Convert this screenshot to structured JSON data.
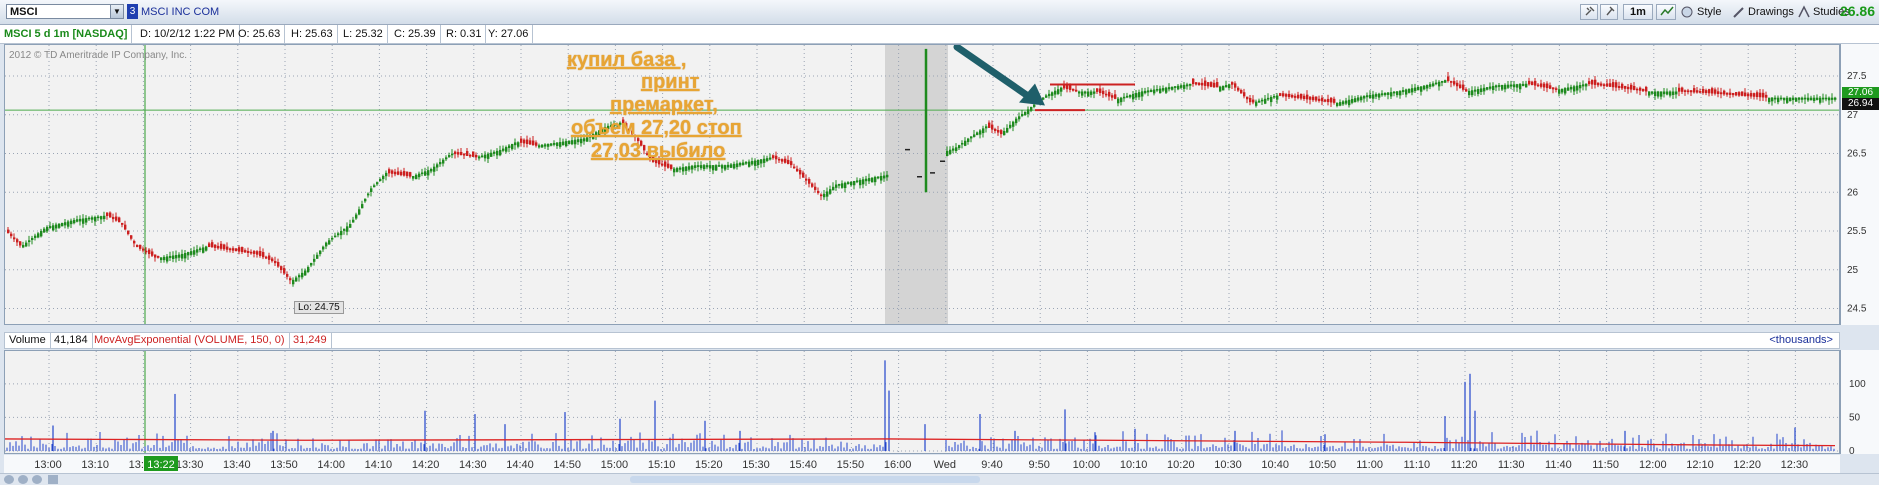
{
  "toolbar": {
    "symbol": "MSCI",
    "link_badge": "3",
    "company": "MSCI INC COM",
    "aggregation": "1m",
    "style_label": "Style",
    "drawings_label": "Drawings",
    "studies_label": "Studies",
    "last_price": "26.86"
  },
  "infobar": {
    "title": "MSCI 5 d 1m [NASDAQ]",
    "date": "D: 10/2/12 1:22 PM",
    "open": "O: 25.63",
    "high": "H: 25.63",
    "low": "L: 25.32",
    "close": "C: 25.39",
    "range": "R: 0.31",
    "y": "Y: 27.06"
  },
  "copyright": "2012 © TD Ameritrade IP Company, Inc.",
  "low_label": "Lo: 24.75",
  "price_tags": {
    "current": "27.06",
    "last": "26.94"
  },
  "annotation": {
    "lines": [
      "купил база ,",
      "принт",
      "премаркет,",
      "объем 27,20 стоп",
      "27,03 выбило"
    ]
  },
  "volume_header": {
    "label": "Volume",
    "value": "41,184",
    "study": "MovAvgExponential (VOLUME, 150, 0)",
    "study_value": "31,249",
    "units": "<thousands>"
  },
  "colors": {
    "up": "#1e8a1e",
    "down": "#cc1f1f",
    "volume": "#2244cc",
    "ema": "#dd2222",
    "annotation": "#e8a534",
    "arrow": "#1f5f6a"
  },
  "chart_data": {
    "type": "candlestick",
    "y_ticks": [
      24.5,
      25,
      25.5,
      26,
      26.5,
      27,
      27.5
    ],
    "ylim": [
      24.3,
      27.9
    ],
    "volume_ticks": [
      0,
      50,
      100
    ],
    "volume_ylim": [
      0,
      140
    ],
    "time_labels": [
      "13:00",
      "13:10",
      "13:20",
      "13:30",
      "13:40",
      "13:50",
      "14:00",
      "14:10",
      "14:20",
      "14:30",
      "14:40",
      "14:50",
      "15:00",
      "15:10",
      "15:20",
      "15:30",
      "15:40",
      "15:50",
      "16:00",
      "Wed",
      "9:40",
      "9:50",
      "10:00",
      "10:10",
      "10:20",
      "10:30",
      "10:40",
      "10:50",
      "11:00",
      "11:10",
      "11:20",
      "11:30",
      "11:40",
      "11:50",
      "12:00",
      "12:10",
      "12:20",
      "12:30"
    ],
    "cursor_time": "13:22",
    "price_path": [
      {
        "x": 0,
        "y": 25.5
      },
      {
        "x": 15,
        "y": 25.3
      },
      {
        "x": 40,
        "y": 25.55
      },
      {
        "x": 70,
        "y": 25.65
      },
      {
        "x": 100,
        "y": 25.7
      },
      {
        "x": 115,
        "y": 25.6
      },
      {
        "x": 130,
        "y": 25.3
      },
      {
        "x": 150,
        "y": 25.15
      },
      {
        "x": 175,
        "y": 25.2
      },
      {
        "x": 200,
        "y": 25.3
      },
      {
        "x": 225,
        "y": 25.25
      },
      {
        "x": 250,
        "y": 25.2
      },
      {
        "x": 268,
        "y": 25.1
      },
      {
        "x": 285,
        "y": 24.85
      },
      {
        "x": 300,
        "y": 25.0
      },
      {
        "x": 320,
        "y": 25.35
      },
      {
        "x": 345,
        "y": 25.6
      },
      {
        "x": 365,
        "y": 26.05
      },
      {
        "x": 380,
        "y": 26.25
      },
      {
        "x": 405,
        "y": 26.2
      },
      {
        "x": 425,
        "y": 26.3
      },
      {
        "x": 445,
        "y": 26.5
      },
      {
        "x": 470,
        "y": 26.45
      },
      {
        "x": 495,
        "y": 26.55
      },
      {
        "x": 510,
        "y": 26.65
      },
      {
        "x": 530,
        "y": 26.6
      },
      {
        "x": 555,
        "y": 26.65
      },
      {
        "x": 580,
        "y": 26.7
      },
      {
        "x": 600,
        "y": 26.85
      },
      {
        "x": 615,
        "y": 26.9
      },
      {
        "x": 630,
        "y": 26.7
      },
      {
        "x": 645,
        "y": 26.4
      },
      {
        "x": 665,
        "y": 26.3
      },
      {
        "x": 690,
        "y": 26.35
      },
      {
        "x": 720,
        "y": 26.35
      },
      {
        "x": 745,
        "y": 26.4
      },
      {
        "x": 765,
        "y": 26.45
      },
      {
        "x": 785,
        "y": 26.35
      },
      {
        "x": 800,
        "y": 26.15
      },
      {
        "x": 815,
        "y": 25.95
      },
      {
        "x": 830,
        "y": 26.1
      },
      {
        "x": 850,
        "y": 26.15
      },
      {
        "x": 870,
        "y": 26.2
      },
      {
        "x": 880,
        "y": 26.22
      },
      {
        "x": 950,
        "y": 26.58
      },
      {
        "x": 965,
        "y": 26.72
      },
      {
        "x": 980,
        "y": 26.85
      },
      {
        "x": 995,
        "y": 26.75
      },
      {
        "x": 1010,
        "y": 26.95
      },
      {
        "x": 1025,
        "y": 27.1
      },
      {
        "x": 1040,
        "y": 27.25
      },
      {
        "x": 1055,
        "y": 27.35
      },
      {
        "x": 1070,
        "y": 27.3
      },
      {
        "x": 1090,
        "y": 27.3
      },
      {
        "x": 1110,
        "y": 27.2
      },
      {
        "x": 1135,
        "y": 27.3
      },
      {
        "x": 1160,
        "y": 27.35
      },
      {
        "x": 1185,
        "y": 27.4
      },
      {
        "x": 1210,
        "y": 27.35
      },
      {
        "x": 1225,
        "y": 27.4
      },
      {
        "x": 1245,
        "y": 27.15
      },
      {
        "x": 1270,
        "y": 27.25
      },
      {
        "x": 1300,
        "y": 27.2
      },
      {
        "x": 1330,
        "y": 27.15
      },
      {
        "x": 1360,
        "y": 27.25
      },
      {
        "x": 1390,
        "y": 27.3
      },
      {
        "x": 1420,
        "y": 27.38
      },
      {
        "x": 1440,
        "y": 27.45
      },
      {
        "x": 1460,
        "y": 27.3
      },
      {
        "x": 1490,
        "y": 27.38
      },
      {
        "x": 1520,
        "y": 27.4
      },
      {
        "x": 1550,
        "y": 27.32
      },
      {
        "x": 1580,
        "y": 27.4
      },
      {
        "x": 1610,
        "y": 27.35
      },
      {
        "x": 1640,
        "y": 27.3
      },
      {
        "x": 1670,
        "y": 27.3
      },
      {
        "x": 1700,
        "y": 27.28
      },
      {
        "x": 1730,
        "y": 27.25
      },
      {
        "x": 1760,
        "y": 27.22
      },
      {
        "x": 1790,
        "y": 27.22
      },
      {
        "x": 1830,
        "y": 27.22
      }
    ],
    "volume_ema": [
      {
        "x": 0,
        "y": 18
      },
      {
        "x": 300,
        "y": 16
      },
      {
        "x": 600,
        "y": 17
      },
      {
        "x": 880,
        "y": 18
      },
      {
        "x": 1100,
        "y": 16
      },
      {
        "x": 1400,
        "y": 13
      },
      {
        "x": 1700,
        "y": 9
      },
      {
        "x": 1830,
        "y": 8
      }
    ],
    "volume_spikes": [
      {
        "x": 48,
        "y": 38
      },
      {
        "x": 170,
        "y": 85
      },
      {
        "x": 268,
        "y": 30
      },
      {
        "x": 420,
        "y": 60
      },
      {
        "x": 470,
        "y": 55
      },
      {
        "x": 500,
        "y": 40
      },
      {
        "x": 560,
        "y": 58
      },
      {
        "x": 615,
        "y": 48
      },
      {
        "x": 650,
        "y": 75
      },
      {
        "x": 700,
        "y": 45
      },
      {
        "x": 735,
        "y": 30
      },
      {
        "x": 880,
        "y": 135
      },
      {
        "x": 884,
        "y": 90
      },
      {
        "x": 920,
        "y": 40
      },
      {
        "x": 975,
        "y": 55
      },
      {
        "x": 1010,
        "y": 30
      },
      {
        "x": 1060,
        "y": 62
      },
      {
        "x": 1090,
        "y": 28
      },
      {
        "x": 1130,
        "y": 33
      },
      {
        "x": 1230,
        "y": 30
      },
      {
        "x": 1320,
        "y": 25
      },
      {
        "x": 1440,
        "y": 52
      },
      {
        "x": 1460,
        "y": 103
      },
      {
        "x": 1465,
        "y": 115
      },
      {
        "x": 1470,
        "y": 60
      },
      {
        "x": 1620,
        "y": 30
      },
      {
        "x": 1790,
        "y": 35
      }
    ]
  }
}
